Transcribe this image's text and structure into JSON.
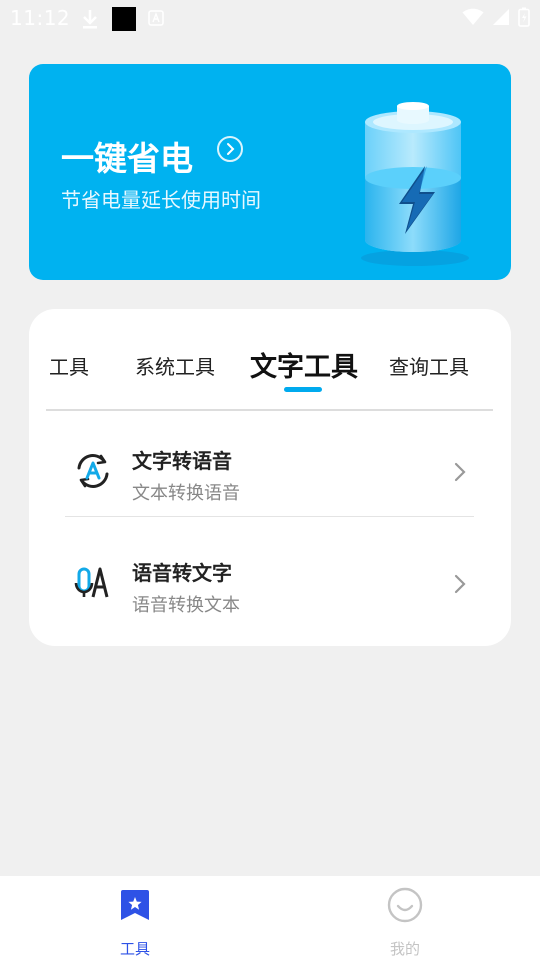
{
  "status_bar": {
    "time": "11:12"
  },
  "banner": {
    "title": "一键省电",
    "subtitle": "节省电量延长使用时间"
  },
  "tabs": [
    {
      "label": "工具"
    },
    {
      "label": "系统工具"
    },
    {
      "label": "文字工具",
      "active": true
    },
    {
      "label": "查询工具"
    }
  ],
  "items": [
    {
      "title": "文字转语音",
      "subtitle": "文本转换语音"
    },
    {
      "title": "语音转文字",
      "subtitle": "语音转换文本"
    }
  ],
  "bottom_nav": [
    {
      "label": "工具",
      "active": true
    },
    {
      "label": "我的",
      "active": false
    }
  ],
  "colors": {
    "accent": "#00b2f0",
    "nav_active": "#2e52e6",
    "nav_inactive": "#c4c4c4"
  }
}
